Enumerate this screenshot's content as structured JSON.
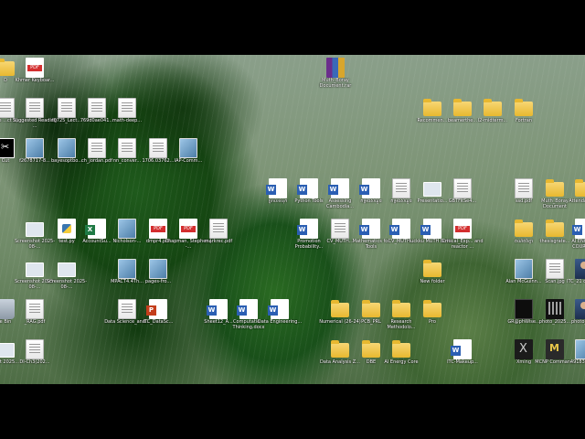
{
  "desktop": {
    "icons": [
      {
        "label": "D",
        "type": "folder"
      },
      {
        "label": "Khmer Keyboar...",
        "type": "pdf"
      },
      {
        "label": "Muth_Boray Document.rar",
        "type": "winrar"
      },
      {
        "label": "obe ...ct X)",
        "type": "doc"
      },
      {
        "label": "Suggested Reading ...",
        "type": "doc"
      },
      {
        "label": "f0725_Lect...",
        "type": "doc"
      },
      {
        "label": "769d0ae041...",
        "type": "doc"
      },
      {
        "label": "math-deep...",
        "type": "doc"
      },
      {
        "label": "Recommen...",
        "type": "folder"
      },
      {
        "label": "beamerthe...",
        "type": "folder"
      },
      {
        "label": "l2-midterm...",
        "type": "folder"
      },
      {
        "label": "Fortran",
        "type": "folder"
      },
      {
        "label": "Cut",
        "type": "capcut"
      },
      {
        "label": "f2678717-8...",
        "type": "img"
      },
      {
        "label": "bayesoptbo...",
        "type": "img"
      },
      {
        "label": "ch_jordan.pdf",
        "type": "doc"
      },
      {
        "label": "nn_conver...",
        "type": "doc"
      },
      {
        "label": "1706.03762...",
        "type": "doc"
      },
      {
        "label": "IAP-Comm...",
        "type": "img"
      },
      {
        "label": "ច្រាលទំនុក",
        "type": "word"
      },
      {
        "label": "Python Tools",
        "type": "word"
      },
      {
        "label": "Assessing Cambodia...",
        "type": "word"
      },
      {
        "label": "កម្រងសំណួរ",
        "type": "word"
      },
      {
        "label": "កម្រងសំណួរ",
        "type": "doc"
      },
      {
        "label": "Presentatio...",
        "type": "screen"
      },
      {
        "label": "GBTFitSe4...",
        "type": "doc"
      },
      {
        "label": "ssd.pdf",
        "type": "doc"
      },
      {
        "label": "Muth_Boray Document",
        "type": "folder"
      },
      {
        "label": "Attendance...",
        "type": "folder"
      },
      {
        "label": "Screenshot 2025-08-...",
        "type": "screen"
      },
      {
        "label": "test.py",
        "type": "py"
      },
      {
        "label": "AccountSu...",
        "type": "excel"
      },
      {
        "label": "Nicholson-...",
        "type": "img"
      },
      {
        "label": "dmpr4.pdf",
        "type": "pdf"
      },
      {
        "label": "Chapman, Stephen J -...",
        "type": "pdf"
      },
      {
        "label": "markrec.pdf",
        "type": "doc"
      },
      {
        "label": "Promotion Probability...",
        "type": "word"
      },
      {
        "label": "CV_MUTH...",
        "type": "doc"
      },
      {
        "label": "Mathematics for Tools",
        "type": "word"
      },
      {
        "label": "CV_MUTH...",
        "type": "word"
      },
      {
        "label": "luckku MUTH Bora...",
        "type": "word"
      },
      {
        "label": "Critical_Exp... and reactor ...",
        "type": "pdf"
      },
      {
        "label": "គណិតវិទ្យា",
        "type": "folder"
      },
      {
        "label": "thesisgrate...",
        "type": "folder"
      },
      {
        "label": "AI ENGIN... COURSE...",
        "type": "word"
      },
      {
        "label": "Screenshot 2025-08-...",
        "type": "screen"
      },
      {
        "label": "Screenshot 2025-08-...",
        "type": "screen"
      },
      {
        "label": "MPACT4.4Th...",
        "type": "img"
      },
      {
        "label": "pages-fro...",
        "type": "img"
      },
      {
        "label": "New folder",
        "type": "folder"
      },
      {
        "label": "Alan McGuinn...",
        "type": "img"
      },
      {
        "label": "Scan.jpg",
        "type": "doc"
      },
      {
        "label": "ITC_21 copy.P...",
        "type": "person"
      },
      {
        "label": "e Bin",
        "type": "bin"
      },
      {
        "label": "_RAG.pdf",
        "type": "doc"
      },
      {
        "label": "Data Science_and...",
        "type": "doc"
      },
      {
        "label": "ITC_DataSc...",
        "type": "ppt"
      },
      {
        "label": "Sheet12_A...",
        "type": "word"
      },
      {
        "label": "Computatio... Thinking.docx",
        "type": "word"
      },
      {
        "label": "Data Engineering...",
        "type": "word"
      },
      {
        "label": "Numerical (26-24)",
        "type": "folder"
      },
      {
        "label": "PCB_PRL",
        "type": "folder"
      },
      {
        "label": "Research Methodolo...",
        "type": "folder"
      },
      {
        "label": "Pro",
        "type": "folder"
      },
      {
        "label": "GR@phWise...",
        "type": "dark"
      },
      {
        "label": "photo_2025...",
        "type": "qr"
      },
      {
        "label": "photo_20...",
        "type": "person"
      },
      {
        "label": "shot 2025...",
        "type": "screen"
      },
      {
        "label": "DI-Ch3(202...",
        "type": "doc"
      },
      {
        "label": "Data Analysis Z...",
        "type": "folder"
      },
      {
        "label": "DBE",
        "type": "folder"
      },
      {
        "label": "AI Energy Core",
        "type": "folder"
      },
      {
        "label": "ITC-Makeup...",
        "type": "word"
      },
      {
        "label": "Xming",
        "type": "xming"
      },
      {
        "label": "MCNP Comman...",
        "type": "app"
      },
      {
        "label": "49183476...",
        "type": "img"
      }
    ]
  }
}
